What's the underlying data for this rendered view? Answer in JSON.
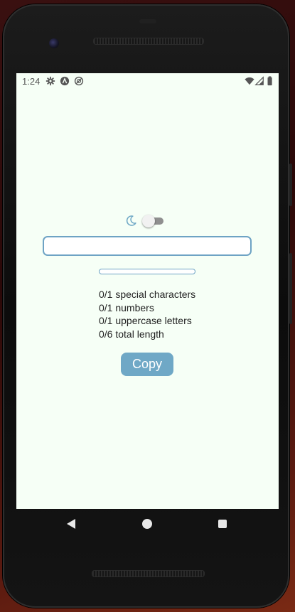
{
  "status_bar": {
    "time": "1:24",
    "icons": [
      "settings-icon",
      "app-a-icon",
      "sync-icon",
      "wifi-icon",
      "signal-icon",
      "battery-icon"
    ]
  },
  "theme_toggle": {
    "icon": "moon-icon",
    "dark_mode_on": false
  },
  "password_input": {
    "value": "",
    "placeholder": ""
  },
  "strength_meter": {
    "fraction": 0
  },
  "requirements": [
    "0/1 special characters",
    "0/1 numbers",
    "0/1 uppercase letters",
    "0/6 total length"
  ],
  "copy_button": {
    "label": "Copy"
  },
  "navigation": {
    "buttons": [
      "back-icon",
      "home-icon",
      "recents-icon"
    ]
  },
  "colors": {
    "accent": "#6fa8c6",
    "background": "#f6fff6",
    "text": "#222222"
  }
}
